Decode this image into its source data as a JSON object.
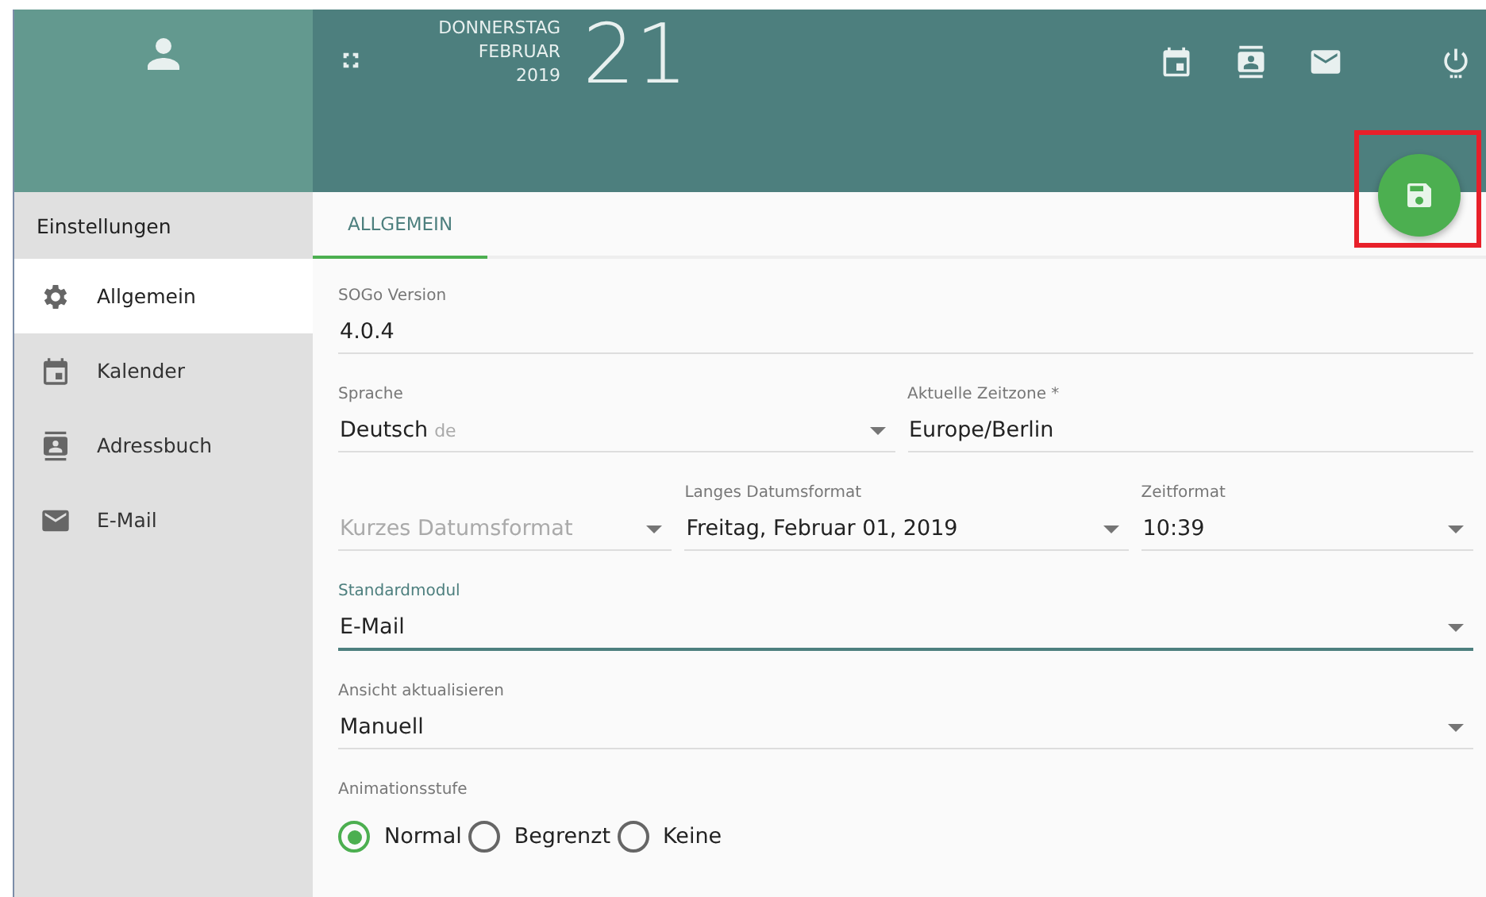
{
  "header": {
    "weekday": "DONNERSTAG",
    "month": "FEBRUAR",
    "year": "2019",
    "day": "21"
  },
  "sidebar": {
    "title": "Einstellungen",
    "items": [
      {
        "label": "Allgemein",
        "kind": "general",
        "selected": true
      },
      {
        "label": "Kalender",
        "kind": "calendar",
        "selected": false
      },
      {
        "label": "Adressbuch",
        "kind": "addressbook",
        "selected": false
      },
      {
        "label": "E-Mail",
        "kind": "mail",
        "selected": false
      }
    ]
  },
  "tabs": [
    {
      "label": "ALLGEMEIN",
      "selected": true
    }
  ],
  "save_button": {
    "highlighted": true
  },
  "rows": [
    [
      {
        "label": "SOGo Version",
        "value": "4.0.4",
        "dropdown": false,
        "disabled": false,
        "focused": false
      }
    ],
    [
      {
        "label": "Sprache",
        "value": "Deutsch",
        "suffix": "de",
        "dropdown": true,
        "disabled": false,
        "focused": false
      },
      {
        "label": "Aktuelle Zeitzone *",
        "value": "Europe/Berlin",
        "dropdown": false,
        "disabled": false,
        "focused": false
      }
    ],
    [
      {
        "placeholder": "Kurzes Datumsformat",
        "dropdown": true,
        "disabled": true,
        "focused": false
      },
      {
        "label": "Langes Datumsformat",
        "value": "Freitag, Februar 01, 2019",
        "dropdown": true,
        "disabled": false,
        "focused": false
      },
      {
        "label": "Zeitformat",
        "value": "10:39",
        "dropdown": true,
        "disabled": false,
        "focused": false
      }
    ],
    [
      {
        "label": "Standardmodul",
        "value": "E-Mail",
        "dropdown": true,
        "disabled": false,
        "focused": true
      }
    ],
    [
      {
        "label": "Ansicht aktualisieren",
        "value": "Manuell",
        "dropdown": true,
        "disabled": false,
        "focused": false
      }
    ]
  ],
  "animation": {
    "label": "Animationsstufe",
    "options": [
      {
        "label": "Normal",
        "selected": true
      },
      {
        "label": "Begrenzt",
        "selected": false
      },
      {
        "label": "Keine",
        "selected": false
      }
    ]
  }
}
